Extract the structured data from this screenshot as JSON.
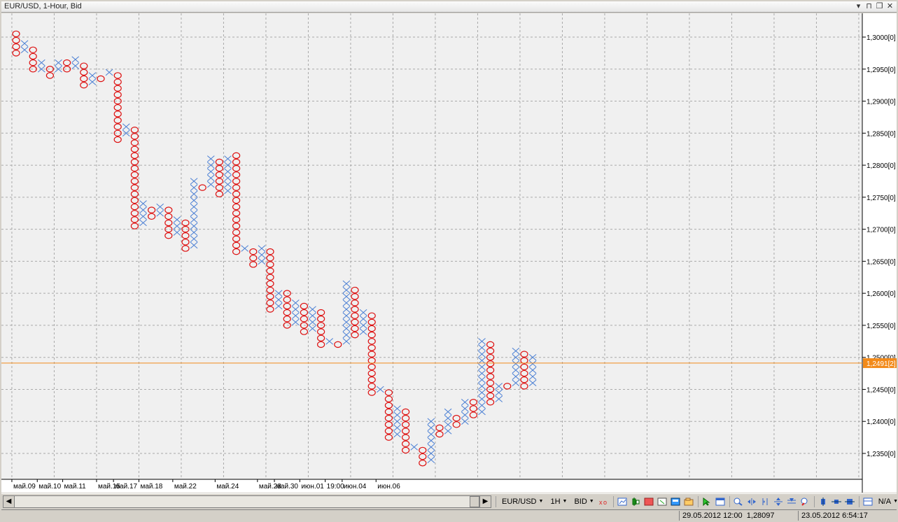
{
  "window": {
    "title": "EUR/USD, 1-Hour, Bid",
    "controls": [
      "▾",
      "⊓",
      "❐",
      "✕"
    ]
  },
  "chart_data": {
    "type": "point-and-figure",
    "symbol": "EUR/USD",
    "timeframe": "1-Hour",
    "price_type": "Bid",
    "box_size": 0.001,
    "ylim": [
      1.231,
      1.306
    ],
    "y_ticks": [
      "1,3000[0]",
      "1,2950[0]",
      "1,2900[0]",
      "1,2850[0]",
      "1,2800[0]",
      "1,2750[0]",
      "1,2700[0]",
      "1,2650[0]",
      "1,2600[0]",
      "1,2550[0]",
      "1,2500[0]",
      "1,2450[0]",
      "1,2400[0]",
      "1,2350[0]"
    ],
    "y_tick_values": [
      1.3,
      1.295,
      1.29,
      1.285,
      1.28,
      1.275,
      1.27,
      1.265,
      1.26,
      1.255,
      1.25,
      1.245,
      1.24,
      1.235
    ],
    "x_labels": [
      "май.09",
      "май.10",
      "май.11",
      "май.15",
      "май.17",
      "май.18",
      "май.22",
      "май.24",
      "май.28",
      "май.30",
      "июн.01",
      "19:00",
      "июн.04",
      "июн.06"
    ],
    "x_label_columns": [
      0,
      3,
      6,
      10,
      12,
      15,
      19,
      24,
      29,
      31,
      34,
      37,
      39,
      43
    ],
    "current_price": 1.2491,
    "current_price_label": "1,2491[2]",
    "columns": [
      {
        "kind": "O",
        "high": 1.301,
        "low": 1.297
      },
      {
        "kind": "X",
        "high": 1.2995,
        "low": 1.2975
      },
      {
        "kind": "O",
        "high": 1.299,
        "low": 1.2945
      },
      {
        "kind": "X",
        "high": 1.2965,
        "low": 1.2945
      },
      {
        "kind": "O",
        "high": 1.296,
        "low": 1.2935
      },
      {
        "kind": "X",
        "high": 1.2965,
        "low": 1.2945
      },
      {
        "kind": "O",
        "high": 1.296,
        "low": 1.2945
      },
      {
        "kind": "X",
        "high": 1.297,
        "low": 1.295
      },
      {
        "kind": "O",
        "high": 1.2965,
        "low": 1.292
      },
      {
        "kind": "X",
        "high": 1.2945,
        "low": 1.2925
      },
      {
        "kind": "O",
        "high": 1.294,
        "low": 1.293
      },
      {
        "kind": "X",
        "high": 1.295,
        "low": 1.294
      },
      {
        "kind": "O",
        "high": 1.2945,
        "low": 1.2835
      },
      {
        "kind": "X",
        "high": 1.287,
        "low": 1.2845
      },
      {
        "kind": "O",
        "high": 1.2865,
        "low": 1.27
      },
      {
        "kind": "X",
        "high": 1.2745,
        "low": 1.2705
      },
      {
        "kind": "O",
        "high": 1.274,
        "low": 1.2715
      },
      {
        "kind": "X",
        "high": 1.274,
        "low": 1.272
      },
      {
        "kind": "O",
        "high": 1.2735,
        "low": 1.2685
      },
      {
        "kind": "X",
        "high": 1.272,
        "low": 1.269
      },
      {
        "kind": "O",
        "high": 1.2715,
        "low": 1.2665
      },
      {
        "kind": "X",
        "high": 1.278,
        "low": 1.267
      },
      {
        "kind": "O",
        "high": 1.277,
        "low": 1.276
      },
      {
        "kind": "X",
        "high": 1.2815,
        "low": 1.2765
      },
      {
        "kind": "O",
        "high": 1.281,
        "low": 1.275
      },
      {
        "kind": "X",
        "high": 1.282,
        "low": 1.2755
      },
      {
        "kind": "O",
        "high": 1.2815,
        "low": 1.266
      },
      {
        "kind": "X",
        "high": 1.2675,
        "low": 1.2665
      },
      {
        "kind": "O",
        "high": 1.267,
        "low": 1.264
      },
      {
        "kind": "X",
        "high": 1.2675,
        "low": 1.2645
      },
      {
        "kind": "O",
        "high": 1.267,
        "low": 1.257
      },
      {
        "kind": "X",
        "high": 1.2605,
        "low": 1.2575
      },
      {
        "kind": "O",
        "high": 1.26,
        "low": 1.2545
      },
      {
        "kind": "X",
        "high": 1.259,
        "low": 1.255
      },
      {
        "kind": "O",
        "high": 1.2585,
        "low": 1.2535
      },
      {
        "kind": "X",
        "high": 1.258,
        "low": 1.254
      },
      {
        "kind": "O",
        "high": 1.2575,
        "low": 1.2515
      },
      {
        "kind": "X",
        "high": 1.253,
        "low": 1.252
      },
      {
        "kind": "O",
        "high": 1.2525,
        "low": 1.2515
      },
      {
        "kind": "X",
        "high": 1.2615,
        "low": 1.252
      },
      {
        "kind": "O",
        "high": 1.261,
        "low": 1.253
      },
      {
        "kind": "X",
        "high": 1.2575,
        "low": 1.2535
      },
      {
        "kind": "O",
        "high": 1.257,
        "low": 1.244
      },
      {
        "kind": "X",
        "high": 1.2455,
        "low": 1.2445
      },
      {
        "kind": "O",
        "high": 1.245,
        "low": 1.237
      },
      {
        "kind": "X",
        "high": 1.2425,
        "low": 1.2375
      },
      {
        "kind": "O",
        "high": 1.242,
        "low": 1.235
      },
      {
        "kind": "X",
        "high": 1.2365,
        "low": 1.2355
      },
      {
        "kind": "O",
        "high": 1.236,
        "low": 1.233
      },
      {
        "kind": "X",
        "high": 1.2405,
        "low": 1.2335
      },
      {
        "kind": "O",
        "high": 1.24,
        "low": 1.2375
      },
      {
        "kind": "X",
        "high": 1.242,
        "low": 1.238
      },
      {
        "kind": "O",
        "high": 1.2415,
        "low": 1.239
      },
      {
        "kind": "X",
        "high": 1.2435,
        "low": 1.2395
      },
      {
        "kind": "O",
        "high": 1.243,
        "low": 1.2405
      },
      {
        "kind": "X",
        "high": 1.2535,
        "low": 1.241
      },
      {
        "kind": "O",
        "high": 1.2525,
        "low": 1.2425
      },
      {
        "kind": "X",
        "high": 1.2465,
        "low": 1.243
      },
      {
        "kind": "O",
        "high": 1.246,
        "low": 1.245
      },
      {
        "kind": "X",
        "high": 1.2515,
        "low": 1.2455
      },
      {
        "kind": "O",
        "high": 1.251,
        "low": 1.245
      },
      {
        "kind": "X",
        "high": 1.251,
        "low": 1.2455
      }
    ],
    "colors": {
      "x": "#4a7fd4",
      "o": "#dd1111",
      "current_price_line": "#f28a1a",
      "grid": "#a9a9a9",
      "background": "#f0f0f0"
    },
    "grid": true
  },
  "toolbar": {
    "symbol": "EUR/USD",
    "timeframe": "1H",
    "price": "BID",
    "zoom": "N/A"
  },
  "status": {
    "cursor_time": "29.05.2012 12:00",
    "cursor_price": "1,28097",
    "server_time": "23.05.2012 6:54:17"
  }
}
